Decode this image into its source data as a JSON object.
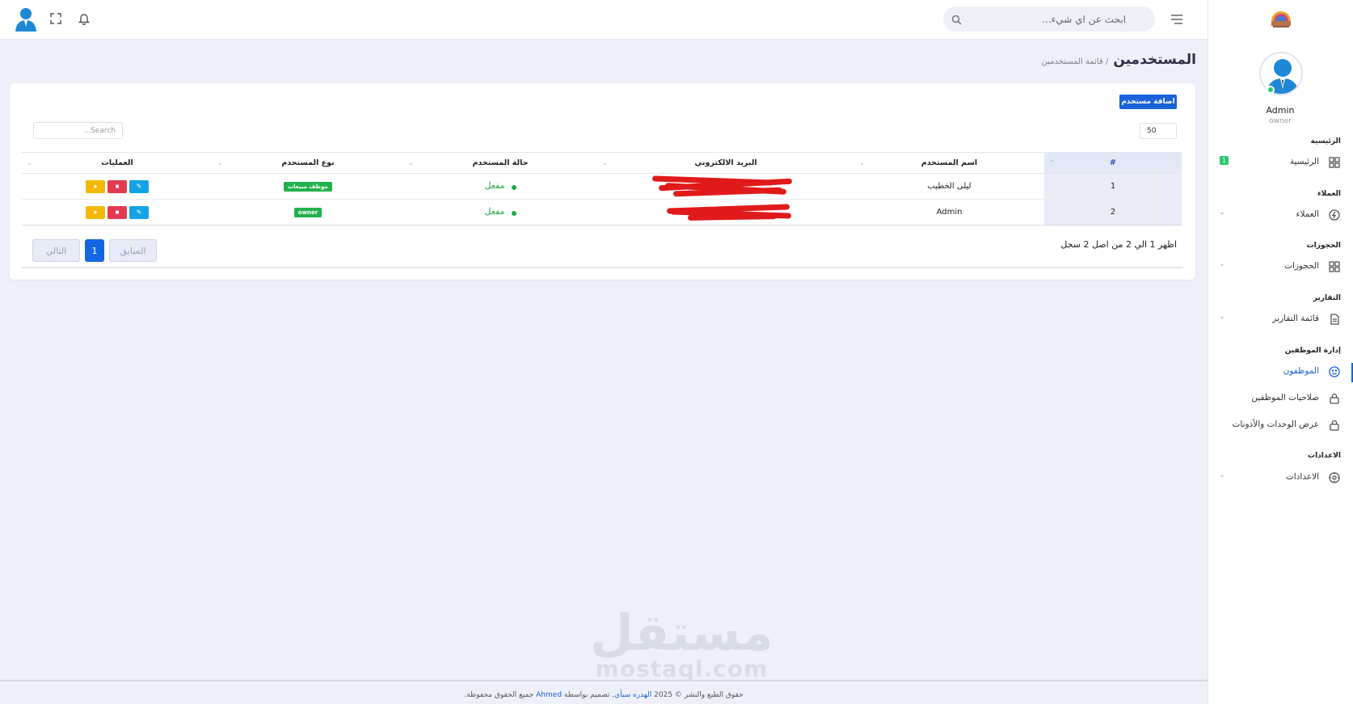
{
  "topbar": {
    "search_placeholder": "ابحث عن اي شيء..."
  },
  "page": {
    "title": "المستخدمين",
    "breadcrumb": "/ قائمة المستخدمين"
  },
  "card": {
    "add_button": "اضافة مستخدم",
    "page_length": "50",
    "search_placeholder": "Search...",
    "columns": [
      "#",
      "اسم المستخدم",
      "البريد الالكتروني",
      "حالة المستخدم",
      "نوع المستخدم",
      "العمليات"
    ],
    "rows": [
      {
        "index": "1",
        "name": "ليلى الخطيب",
        "status": "مفعل",
        "type": "موظف مبيعات"
      },
      {
        "index": "2",
        "name": "Admin",
        "status": "مفعل",
        "type": "owner"
      }
    ],
    "info": "اظهر 1 الي 2 من اصل 2 سجل",
    "pagination": {
      "prev": "السابق",
      "current": "1",
      "next": "التالي"
    }
  },
  "watermark": {
    "arabic": "مستقل",
    "latin": "mostaql.com"
  },
  "footer": {
    "prefix": "حقوق الطبع والنشر © 2025",
    "brand": "الهدره سبأي",
    "middle": ", تصميم بواسطة",
    "author": "Ahmed",
    "suffix": "جميع الحقوق محفوظة."
  },
  "sidebar": {
    "profile_name": "Admin",
    "profile_role": "owner",
    "sections": [
      {
        "title": "الرئيسية",
        "item": "الرئيسية",
        "icon": "grid-icon",
        "badge": "1"
      },
      {
        "title": "العملاء",
        "item": "العملاء",
        "icon": "bolt-icon"
      },
      {
        "title": "الحجوزات",
        "item": "الحجوزات",
        "icon": "grid-icon"
      },
      {
        "title": "التقارير",
        "item": "قائمة التقارير",
        "icon": "document-icon"
      },
      {
        "title": "إدارة الموظفين",
        "items": [
          "الموظفون",
          "صلاحيات الموظفين",
          "عرض الوحدات والأذونات"
        ]
      },
      {
        "title": "الاعدادات",
        "item": "الاعدادات",
        "icon": "settings-icon"
      }
    ]
  },
  "colors": {
    "primary": "#1a62d9",
    "success": "#28c76f",
    "danger": "#e23b50",
    "warning": "#f5b800",
    "info": "#14a3e6"
  }
}
